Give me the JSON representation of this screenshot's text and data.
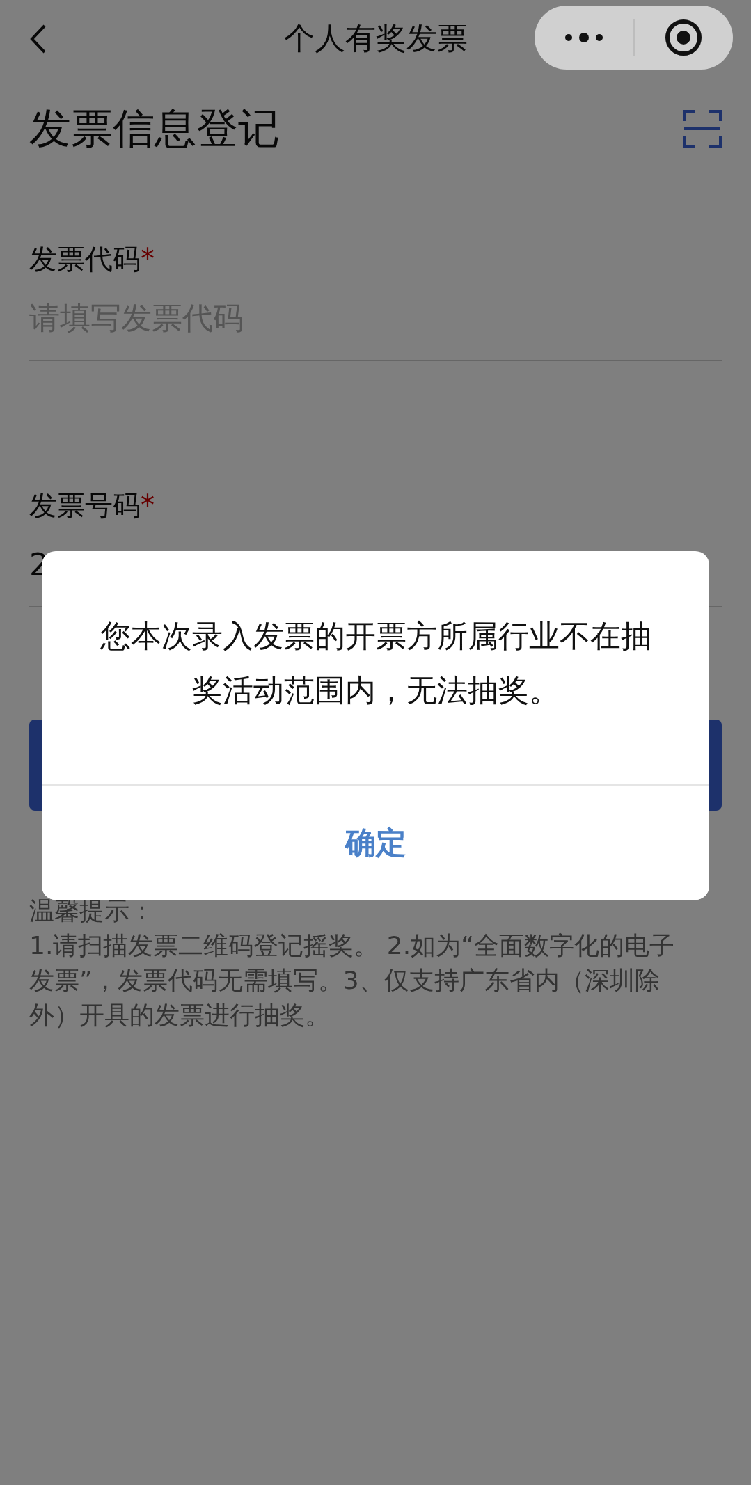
{
  "nav": {
    "title": "个人有奖发票"
  },
  "heading": "发票信息登记",
  "fields": [
    {
      "label": "发票代码",
      "required_mark": "*",
      "placeholder": "请填写发票代码"
    },
    {
      "label": "发票号码",
      "required_mark": "*",
      "value": "2"
    }
  ],
  "tips": {
    "title": "温馨提示：",
    "text": "1.请扫描发票二维码登记摇奖。 2.如为“全面数字化的电子发票”，发票代码无需填写。3、仅支持广东省内（深圳除外）开具的发票进行抽奖。"
  },
  "dialog": {
    "message": "您本次录入发票的开票方所属行业不在抽奖活动范围内，无法抽奖。",
    "button": "确定"
  }
}
